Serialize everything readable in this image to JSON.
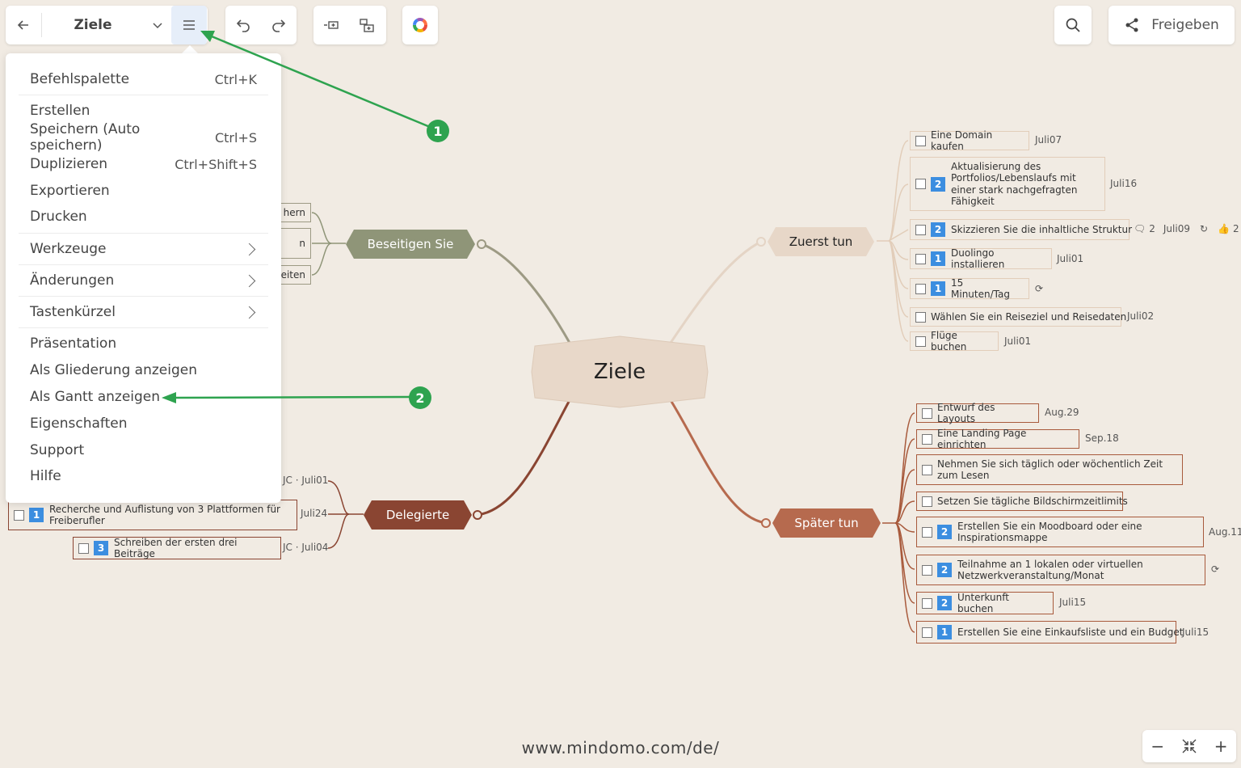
{
  "toolbar": {
    "map_title": "Ziele",
    "share_label": "Freigeben"
  },
  "menu": {
    "items": [
      {
        "label": "Befehlspalette",
        "shortcut": "Ctrl+K"
      },
      {
        "label": "Erstellen",
        "shortcut": ""
      },
      {
        "label": "Speichern (Auto speichern)",
        "shortcut": "Ctrl+S"
      },
      {
        "label": "Duplizieren",
        "shortcut": "Ctrl+Shift+S"
      },
      {
        "label": "Exportieren",
        "shortcut": ""
      },
      {
        "label": "Drucken",
        "shortcut": ""
      },
      {
        "label": "Werkzeuge",
        "shortcut": ""
      },
      {
        "label": "Änderungen",
        "shortcut": ""
      },
      {
        "label": "Tastenkürzel",
        "shortcut": ""
      },
      {
        "label": "Präsentation",
        "shortcut": ""
      },
      {
        "label": "Als Gliederung anzeigen",
        "shortcut": ""
      },
      {
        "label": "Als Gantt anzeigen",
        "shortcut": ""
      },
      {
        "label": "Eigenschaften",
        "shortcut": ""
      },
      {
        "label": "Support",
        "shortcut": ""
      },
      {
        "label": "Hilfe",
        "shortcut": ""
      }
    ]
  },
  "annotations": {
    "marker1": "1",
    "marker2": "2"
  },
  "map": {
    "center": "Ziele",
    "beseitigen": {
      "label": "Beseitigen Sie",
      "partial": [
        "hern",
        "n",
        "eiten"
      ]
    },
    "delegierte": {
      "label": "Delegierte",
      "tasks": [
        {
          "meta": "JC · Juli01"
        },
        {
          "text": "Recherche und Auflistung von 3 Plattformen für Freiberufler",
          "priority": "1",
          "meta": "Juli24"
        },
        {
          "text": "Schreiben der ersten drei Beiträge",
          "priority": "3",
          "meta": "JC · Juli04"
        }
      ]
    },
    "zuerst": {
      "label": "Zuerst tun",
      "tasks": [
        {
          "text": "Eine Domain kaufen",
          "priority": "",
          "meta": "Juli07"
        },
        {
          "text": "Aktualisierung des Portfolios/Lebenslaufs mit einer stark nachgefragten Fähigkeit",
          "priority": "2",
          "meta": "Juli16"
        },
        {
          "text": "Skizzieren Sie die inhaltliche Struktur",
          "priority": "2",
          "meta": "Juli09",
          "comments": "2",
          "likes": "2"
        },
        {
          "text": "Duolingo installieren",
          "priority": "1",
          "meta": "Juli01"
        },
        {
          "text": "15 Minuten/Tag",
          "priority": "1",
          "meta": ""
        },
        {
          "text": "Wählen Sie ein Reiseziel und Reisedaten",
          "priority": "",
          "meta": "Juli02"
        },
        {
          "text": "Flüge buchen",
          "priority": "",
          "meta": "Juli01"
        }
      ]
    },
    "spaeter": {
      "label": "Später tun",
      "tasks": [
        {
          "text": "Entwurf des Layouts",
          "priority": "",
          "meta": "Aug.29"
        },
        {
          "text": "Eine Landing Page einrichten",
          "priority": "",
          "meta": "Sep.18"
        },
        {
          "text": "Nehmen Sie sich täglich oder wöchentlich Zeit zum Lesen",
          "priority": "",
          "meta": ""
        },
        {
          "text": "Setzen Sie tägliche Bildschirmzeitlimits",
          "priority": "",
          "meta": ""
        },
        {
          "text": "Erstellen Sie ein Moodboard oder eine Inspirationsmappe",
          "priority": "2",
          "meta": "Aug.11"
        },
        {
          "text": "Teilnahme an 1 lokalen oder virtuellen Netzwerkveranstaltung/Monat",
          "priority": "2",
          "meta": ""
        },
        {
          "text": "Unterkunft buchen",
          "priority": "2",
          "meta": "Juli15"
        },
        {
          "text": "Erstellen Sie eine Einkaufsliste und ein Budget",
          "priority": "1",
          "meta": "Juli15"
        }
      ]
    }
  },
  "footer": {
    "url": "www.mindomo.com/de/"
  },
  "colors": {
    "background": "#f1ebe3",
    "beseitigen": "#8f9578",
    "delegierte": "#8a4532",
    "zuerst": "#e7d7c8",
    "spaeter": "#b66a4e",
    "marker": "#2ea34f"
  }
}
